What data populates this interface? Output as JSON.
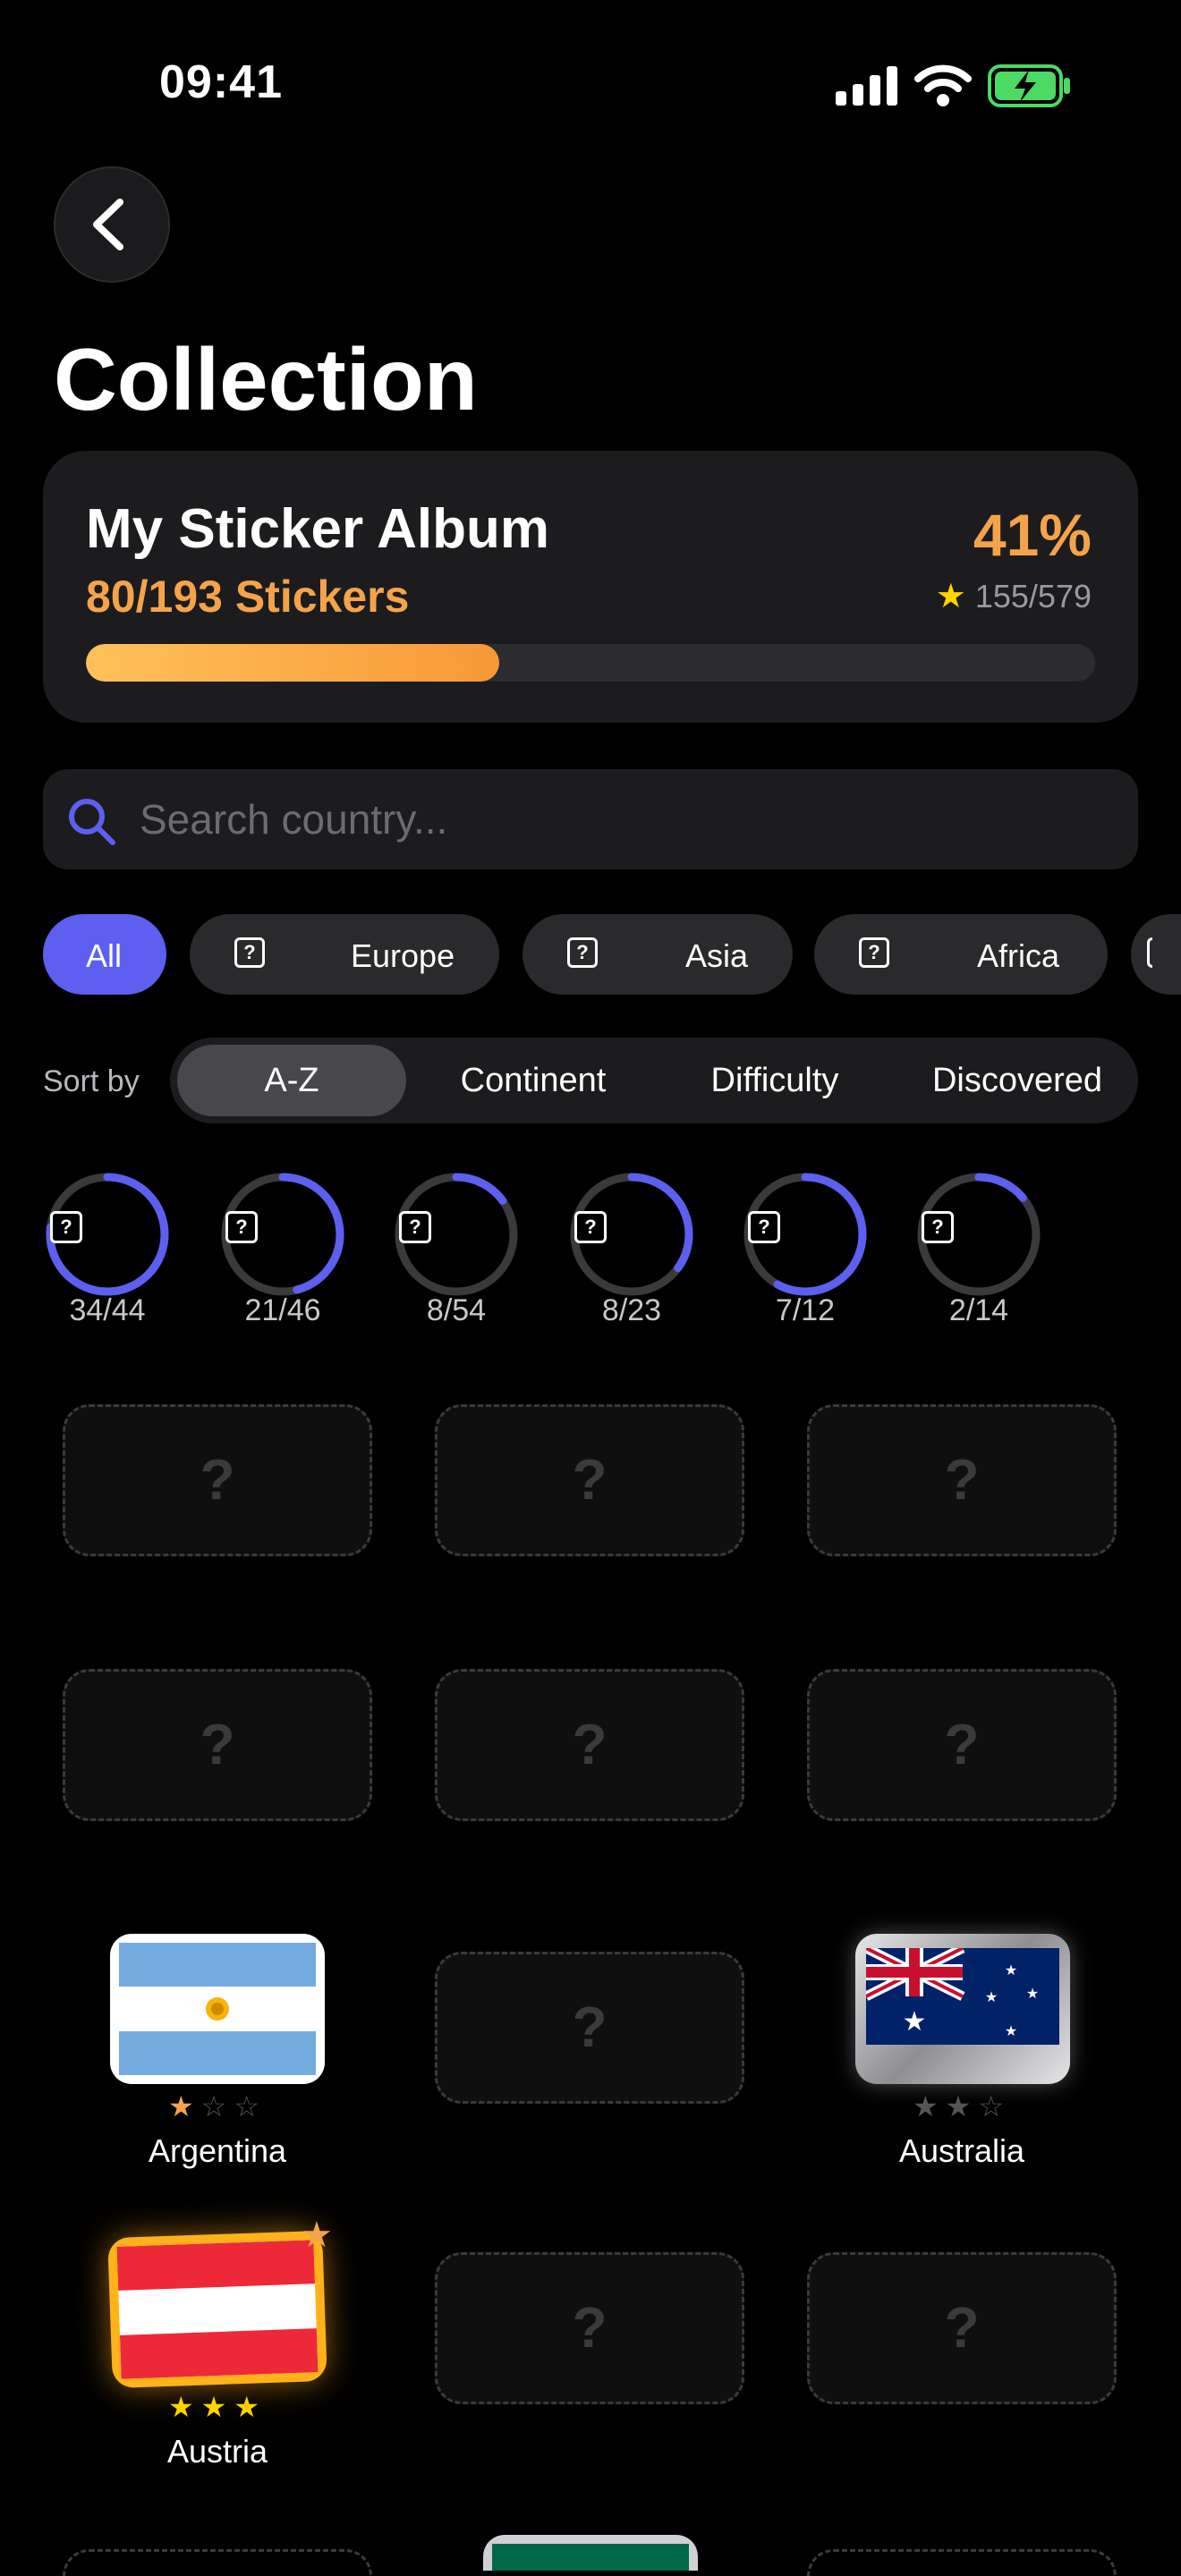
{
  "status_bar": {
    "time": "09:41"
  },
  "header": {
    "title": "Collection"
  },
  "album": {
    "title": "My Sticker Album",
    "count": "80/193 Stickers",
    "percent": "41%",
    "stars": "155/579",
    "progress": 0.41
  },
  "search": {
    "placeholder": "Search country..."
  },
  "filters": [
    {
      "label": "All",
      "active": true
    },
    {
      "label": "Europe"
    },
    {
      "label": "Asia"
    },
    {
      "label": "Africa"
    }
  ],
  "sort": {
    "label": "Sort by",
    "options": [
      "A-Z",
      "Continent",
      "Difficulty",
      "Discovered"
    ],
    "selected": "A-Z"
  },
  "continent_progress": [
    {
      "value": "34/44",
      "fraction": 0.77
    },
    {
      "value": "21/46",
      "fraction": 0.46
    },
    {
      "value": "8/54",
      "fraction": 0.15
    },
    {
      "value": "8/23",
      "fraction": 0.35
    },
    {
      "value": "7/12",
      "fraction": 0.58
    },
    {
      "value": "2/14",
      "fraction": 0.14
    }
  ],
  "stickers": {
    "locked_mark": "?",
    "argentina": {
      "name": "Argentina",
      "stars": 1
    },
    "australia": {
      "name": "Australia",
      "stars": 2
    },
    "austria": {
      "name": "Austria",
      "stars": 3
    }
  },
  "colors": {
    "accent": "#5d5ff0",
    "orange": "#f5a34b",
    "gold": "#ffd200"
  }
}
